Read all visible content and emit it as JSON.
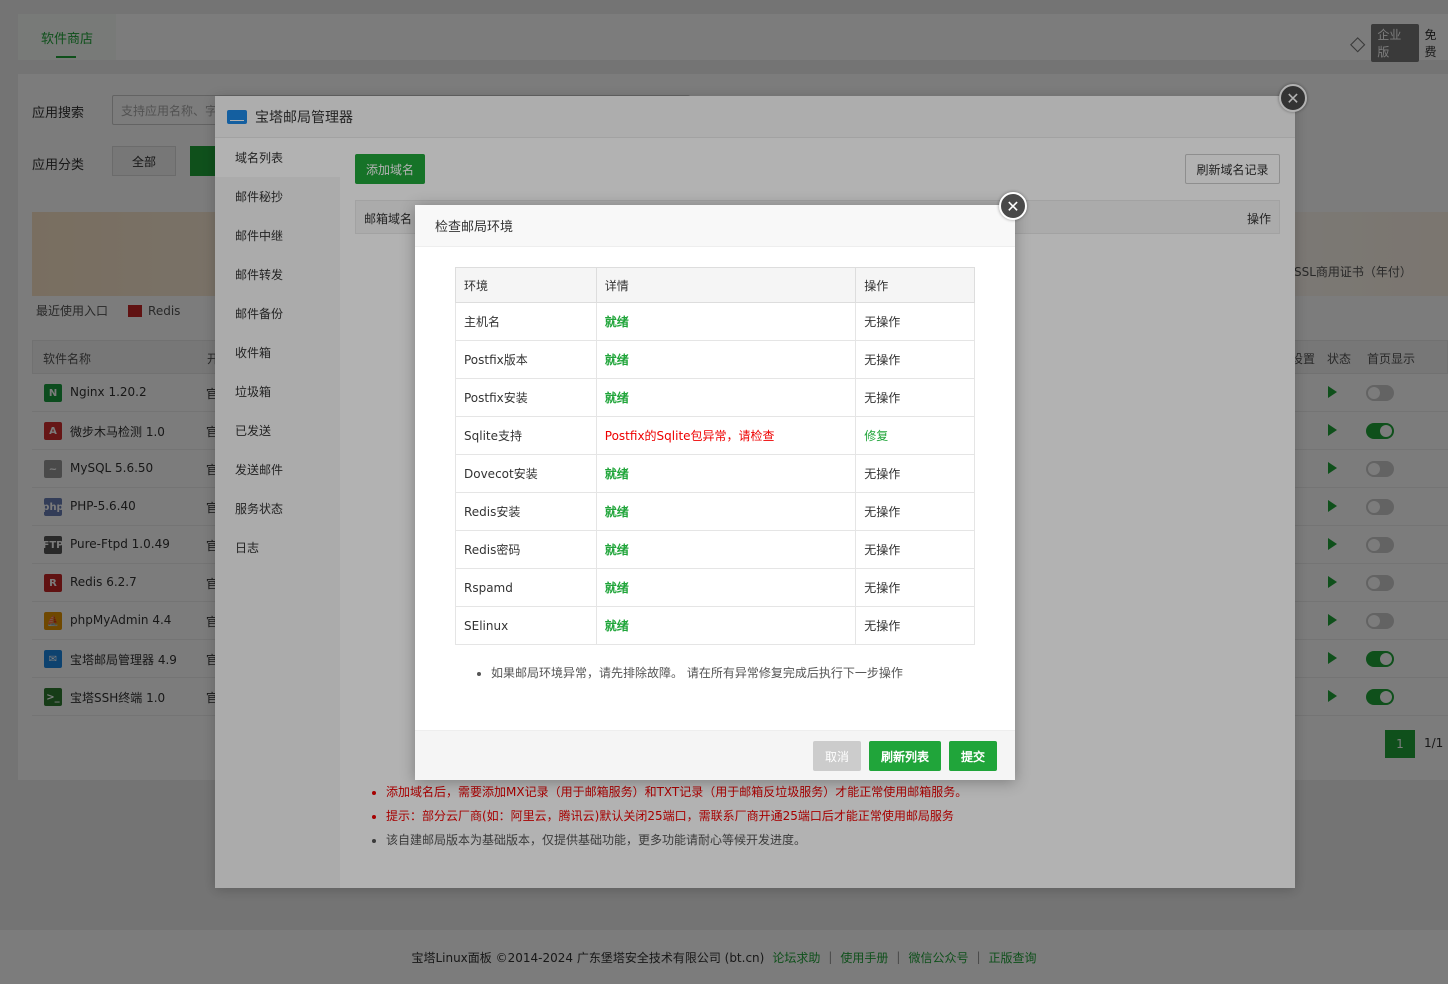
{
  "background": {
    "tab_label": "软件商店",
    "enterprise_label": "企业版",
    "free_label": "免费",
    "search_label": "应用搜索",
    "search_placeholder": "支持应用名称、字段模糊搜索",
    "category_label": "应用分类",
    "category_all": "全部",
    "banner_text": "SSL商用证书（年付）",
    "recent_label": "最近使用入口",
    "recent_item": "Redis",
    "table_headers": {
      "name": "软件名称",
      "kai": "开",
      "set": "设置",
      "status": "状态",
      "home": "首页显示"
    },
    "rows": [
      {
        "name": "Nginx 1.20.2",
        "kai": "官",
        "icon_color": "#1b9e3e",
        "icon_text": "N",
        "toggle": false
      },
      {
        "name": "微步木马检测 1.0",
        "kai": "官",
        "icon_color": "#d32f2f",
        "icon_text": "A",
        "toggle": true
      },
      {
        "name": "MySQL 5.6.50",
        "kai": "官",
        "icon_color": "#999999",
        "icon_text": "~",
        "toggle": false
      },
      {
        "name": "PHP-5.6.40",
        "kai": "官",
        "icon_color": "#6a7fb5",
        "icon_text": "php",
        "toggle": false
      },
      {
        "name": "Pure-Ftpd 1.0.49",
        "kai": "官",
        "icon_color": "#555555",
        "icon_text": "FTP",
        "toggle": false
      },
      {
        "name": "Redis 6.2.7",
        "kai": "官",
        "icon_color": "#c62828",
        "icon_text": "R",
        "toggle": false
      },
      {
        "name": "phpMyAdmin 4.4",
        "kai": "官",
        "icon_color": "#e69500",
        "icon_text": "⛵",
        "toggle": false
      },
      {
        "name": "宝塔邮局管理器 4.9",
        "kai": "官",
        "icon_color": "#1e88e5",
        "icon_text": "✉",
        "toggle": true
      },
      {
        "name": "宝塔SSH终端 1.0",
        "kai": "官",
        "icon_color": "#2e7d32",
        "icon_text": ">_",
        "toggle": true
      }
    ],
    "pager_current": "1",
    "pager_total": "1/1",
    "footer": {
      "copyright": "宝塔Linux面板 ©2014-2024 广东堡塔安全技术有限公司 (bt.cn)",
      "links": [
        "论坛求助",
        "使用手册",
        "微信公众号",
        "正版查询"
      ],
      "sep": "|"
    }
  },
  "mail_manager": {
    "title": "宝塔邮局管理器",
    "sidebar": [
      "域名列表",
      "邮件秘抄",
      "邮件中继",
      "邮件转发",
      "邮件备份",
      "收件箱",
      "垃圾箱",
      "已发送",
      "发送邮件",
      "服务状态",
      "日志"
    ],
    "add_domain": "添加域名",
    "refresh_domain": "刷新域名记录",
    "col_domain": "邮箱域名",
    "col_action": "操作",
    "notes": [
      {
        "text": "添加域名后，需要添加MX记录（用于邮箱服务）和TXT记录（用于邮箱反垃圾服务）才能正常使用邮箱服务。",
        "color": "red"
      },
      {
        "text": "提示：部分云厂商(如：阿里云，腾讯云)默认关闭25端口，需联系厂商开通25端口后才能正常使用邮局服务",
        "color": "red"
      },
      {
        "text": "该自建邮局版本为基础版本，仅提供基础功能，更多功能请耐心等候开发进度。",
        "color": "gray"
      }
    ]
  },
  "env_dialog": {
    "title": "检查邮局环境",
    "headers": [
      "环境",
      "详情",
      "操作"
    ],
    "rows": [
      {
        "env": "主机名",
        "detail": "就绪",
        "detail_ok": true,
        "action": "无操作"
      },
      {
        "env": "Postfix版本",
        "detail": "就绪",
        "detail_ok": true,
        "action": "无操作"
      },
      {
        "env": "Postfix安装",
        "detail": "就绪",
        "detail_ok": true,
        "action": "无操作"
      },
      {
        "env": "Sqlite支持",
        "detail": "Postfix的Sqlite包异常，请检查",
        "detail_ok": false,
        "action": "修复"
      },
      {
        "env": "Dovecot安装",
        "detail": "就绪",
        "detail_ok": true,
        "action": "无操作"
      },
      {
        "env": "Redis安装",
        "detail": "就绪",
        "detail_ok": true,
        "action": "无操作"
      },
      {
        "env": "Redis密码",
        "detail": "就绪",
        "detail_ok": true,
        "action": "无操作"
      },
      {
        "env": "Rspamd",
        "detail": "就绪",
        "detail_ok": true,
        "action": "无操作"
      },
      {
        "env": "SElinux",
        "detail": "就绪",
        "detail_ok": true,
        "action": "无操作"
      }
    ],
    "tip": "如果邮局环境异常，请先排除故障。 请在所有异常修复完成后执行下一步操作",
    "cancel": "取消",
    "refresh": "刷新列表",
    "submit": "提交"
  }
}
